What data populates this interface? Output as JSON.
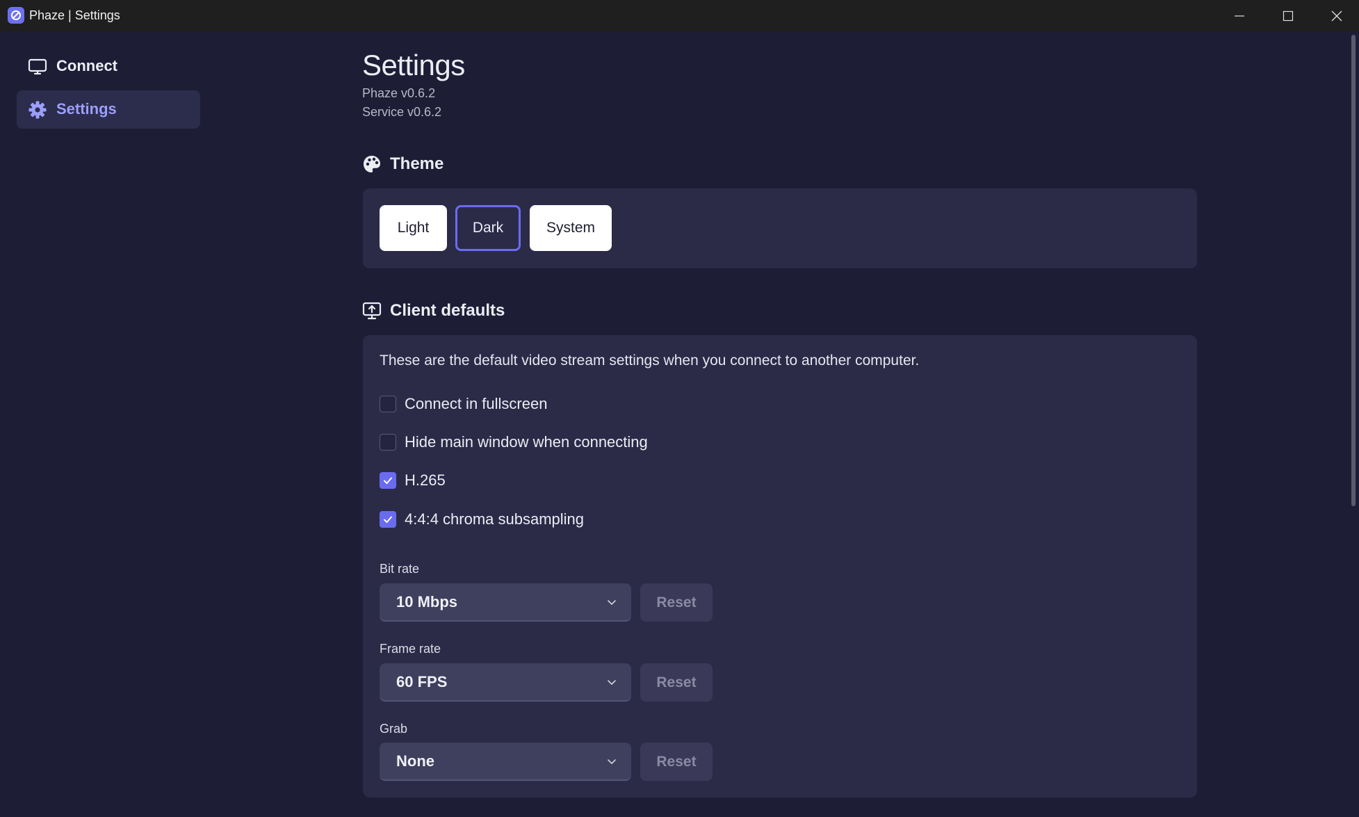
{
  "window": {
    "title": "Phaze | Settings"
  },
  "sidebar": {
    "items": [
      {
        "label": "Connect",
        "icon": "monitor-icon"
      },
      {
        "label": "Settings",
        "icon": "gear-icon",
        "active": true
      }
    ]
  },
  "header": {
    "title": "Settings",
    "app_version": "Phaze v0.6.2",
    "service_version": "Service v0.6.2"
  },
  "theme": {
    "heading": "Theme",
    "options": [
      "Light",
      "Dark",
      "System"
    ],
    "selected": "Dark"
  },
  "client_defaults": {
    "heading": "Client defaults",
    "description": "These are the default video stream settings when you connect to another computer.",
    "checkboxes": [
      {
        "label": "Connect in fullscreen",
        "checked": false
      },
      {
        "label": "Hide main window when connecting",
        "checked": false
      },
      {
        "label": "H.265",
        "checked": true
      },
      {
        "label": "4:4:4 chroma subsampling",
        "checked": true
      }
    ],
    "bit_rate": {
      "label": "Bit rate",
      "value": "10 Mbps",
      "reset": "Reset"
    },
    "frame_rate": {
      "label": "Frame rate",
      "value": "60 FPS",
      "reset": "Reset"
    },
    "grab": {
      "label": "Grab",
      "value": "None",
      "reset": "Reset"
    }
  },
  "colors": {
    "background": "#1d1d36",
    "card": "#2b2b48",
    "accent": "#6a6cf0",
    "active_nav_text": "#9b9ff8"
  }
}
